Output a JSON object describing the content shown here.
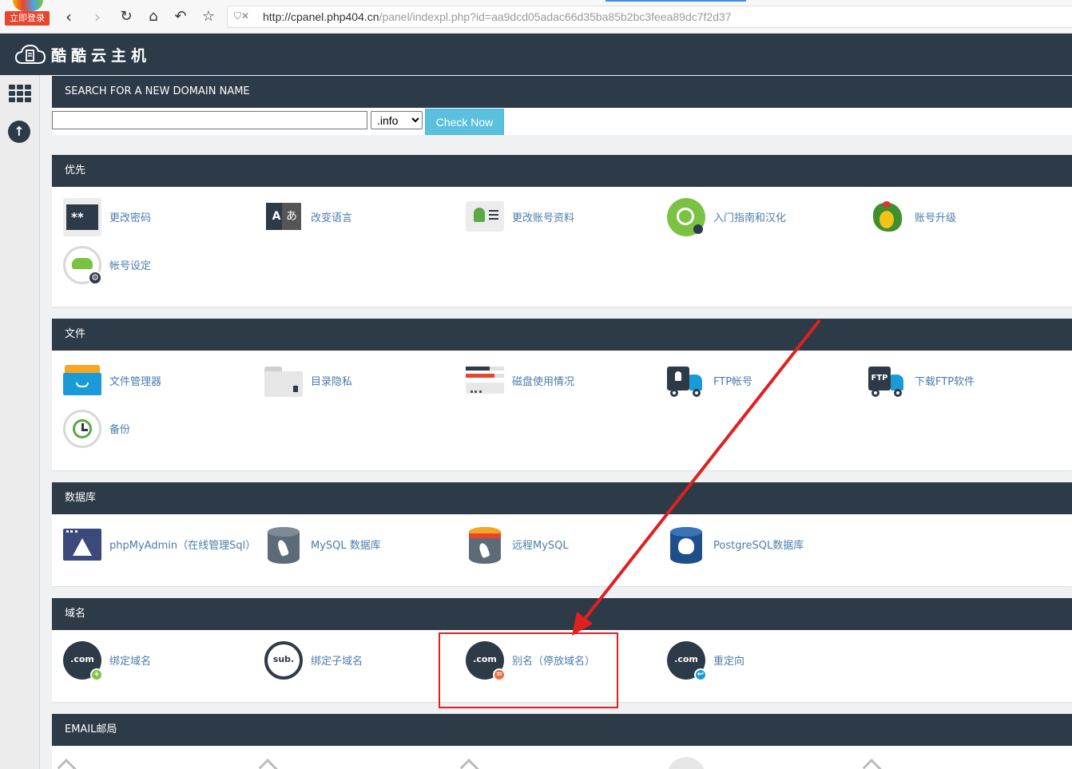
{
  "browser": {
    "login_badge": "立即登录",
    "url_host": "http://cpanel.php404.cn",
    "url_path": "/panel/indexpl.php?id=aa9dcd05adac66d35ba85b2bc3feea89dc7f2d37"
  },
  "header": {
    "brand": "酷酷云主机"
  },
  "search": {
    "title": "SEARCH FOR A NEW DOMAIN NAME",
    "input_value": "",
    "tld_selected": ".info",
    "button": "Check Now"
  },
  "groups": {
    "priority": {
      "title": "优先",
      "items": [
        "更改密码",
        "改变语言",
        "更改账号资料",
        "入门指南和汉化",
        "账号升级",
        "帐号设定"
      ]
    },
    "files": {
      "title": "文件",
      "items": [
        "文件管理器",
        "目录隐私",
        "磁盘使用情况",
        "FTP帐号",
        "下载FTP软件",
        "备份"
      ]
    },
    "database": {
      "title": "数据库",
      "items": [
        "phpMyAdmin（在线管理Sql）",
        "MySQL 数据库",
        "远程MySQL",
        "PostgreSQL数据库"
      ]
    },
    "domains": {
      "title": "域名",
      "items": [
        "绑定域名",
        "绑定子域名",
        "别名（停放域名）",
        "重定向"
      ],
      "icon_text": [
        ".com",
        "sub.",
        ".com",
        ".com"
      ]
    },
    "email": {
      "title": "EMAIL邮局"
    }
  },
  "icons": {
    "password": "**",
    "language_a": "A",
    "language_b": "あ",
    "ftp": "FTP"
  },
  "colors": {
    "header_bg": "#2d3a47",
    "link": "#4b7cad",
    "check_button": "#5bc0de",
    "highlight": "#e02020"
  }
}
